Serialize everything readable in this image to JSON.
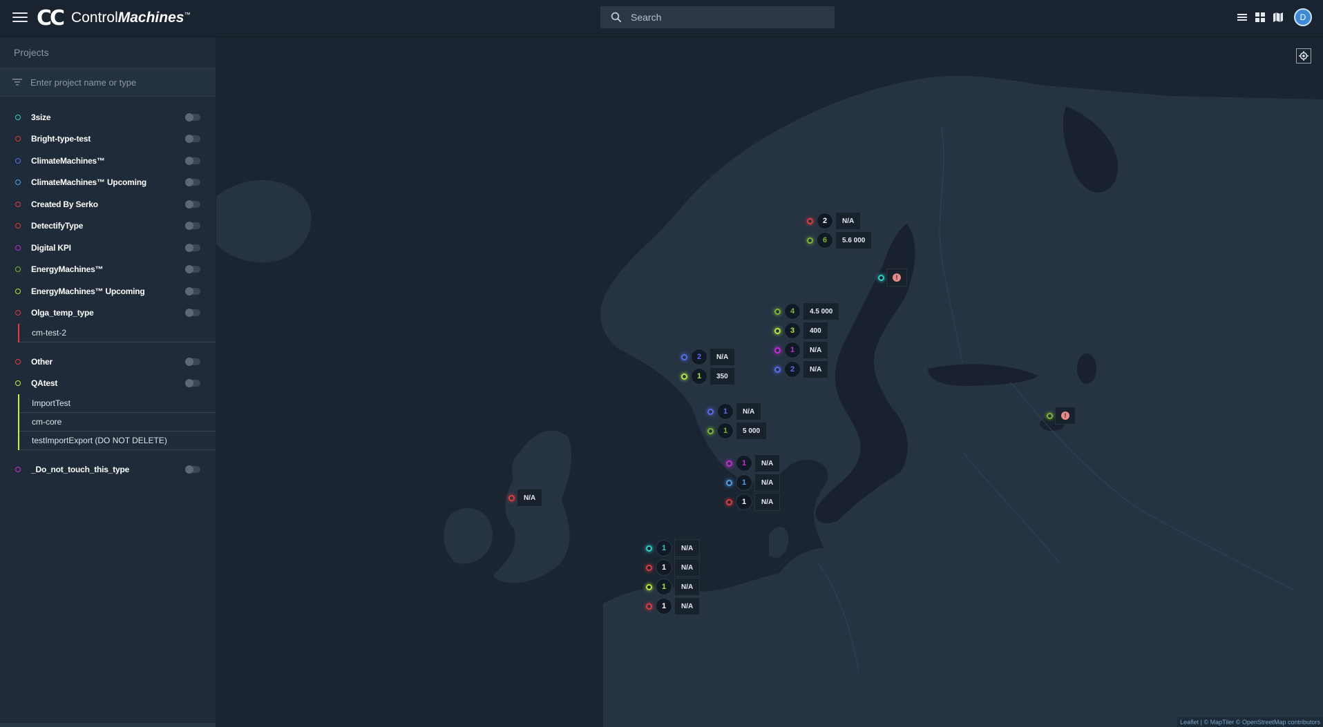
{
  "header": {
    "logo_mark": "CC",
    "logo_name_a": "Control",
    "logo_name_b": "Machines",
    "logo_tm": "™",
    "search_placeholder": "Search"
  },
  "sidebar": {
    "title": "Projects",
    "filter_placeholder": "Enter project name or type",
    "projects": [
      {
        "label": "3size",
        "color": "#2fd3c5"
      },
      {
        "label": "Bright-type-test",
        "color": "#e23b3b"
      },
      {
        "label": "ClimateMachines™",
        "color": "#5a6cf0"
      },
      {
        "label": "ClimateMachines™ Upcoming",
        "color": "#4aa3f0"
      },
      {
        "label": "Created By Serko",
        "color": "#e23b3b"
      },
      {
        "label": "DetectifyType",
        "color": "#e23b3b"
      },
      {
        "label": "Digital KPI",
        "color": "#c62bd6"
      },
      {
        "label": "EnergyMachines™",
        "color": "#7fb72f"
      },
      {
        "label": "EnergyMachines™ Upcoming",
        "color": "#b9e83a"
      },
      {
        "label": "Olga_temp_type",
        "color": "#e23b3b",
        "children": [
          "cm-test-2"
        ]
      },
      {
        "label": "Other",
        "color": "#e23b3b"
      },
      {
        "label": "QAtest",
        "color": "#c9f03a",
        "children": [
          "ImportTest",
          "cm-core",
          "testImportExport (DO NOT DELETE)"
        ]
      },
      {
        "label": "_Do_not_touch_this_type",
        "color": "#d52bd6"
      }
    ]
  },
  "map": {
    "attribution": "Leaflet | © MapTiler © OpenStreetMap contributors",
    "clusters": [
      {
        "rows": [
          {
            "color": "#e23b3b",
            "count": "2",
            "value": "N/A"
          },
          {
            "color": "#7fb72f",
            "count": "6",
            "value": "5.6 000"
          }
        ]
      },
      {
        "rows": [
          {
            "color": "#2fd3c5",
            "alert": "!"
          }
        ]
      },
      {
        "rows": [
          {
            "color": "#7fb72f",
            "count": "4",
            "value": "4.5 000"
          },
          {
            "color": "#b9e83a",
            "count": "3",
            "value": "400"
          },
          {
            "color": "#c62bd6",
            "count": "1",
            "value": "N/A"
          },
          {
            "color": "#5a6cf0",
            "count": "2",
            "value": "N/A"
          }
        ]
      },
      {
        "rows": [
          {
            "color": "#5a6cf0",
            "count": "2",
            "value": "N/A"
          },
          {
            "color": "#b9e83a",
            "count": "1",
            "value": "350"
          }
        ]
      },
      {
        "rows": [
          {
            "color": "#5a6cf0",
            "count": "1",
            "value": "N/A"
          },
          {
            "color": "#7fb72f",
            "count": "1",
            "value": "5 000"
          }
        ]
      },
      {
        "rows": [
          {
            "color": "#7fb72f",
            "alert": "!"
          }
        ]
      },
      {
        "rows": [
          {
            "color": "#c62bd6",
            "count": "1",
            "value": "N/A"
          },
          {
            "color": "#4aa3f0",
            "count": "1",
            "value": "N/A"
          },
          {
            "color": "#e23b3b",
            "count": "1",
            "value": "N/A"
          }
        ]
      },
      {
        "rows": [
          {
            "color": "#e23b3b",
            "value": "N/A"
          }
        ]
      },
      {
        "rows": [
          {
            "color": "#2fd3c5",
            "count": "1",
            "value": "N/A"
          },
          {
            "color": "#e23b3b",
            "count": "1",
            "value": "N/A"
          },
          {
            "color": "#b9e83a",
            "count": "1",
            "value": "N/A"
          },
          {
            "color": "#e23b3b",
            "count": "1",
            "value": "N/A"
          }
        ]
      }
    ]
  }
}
